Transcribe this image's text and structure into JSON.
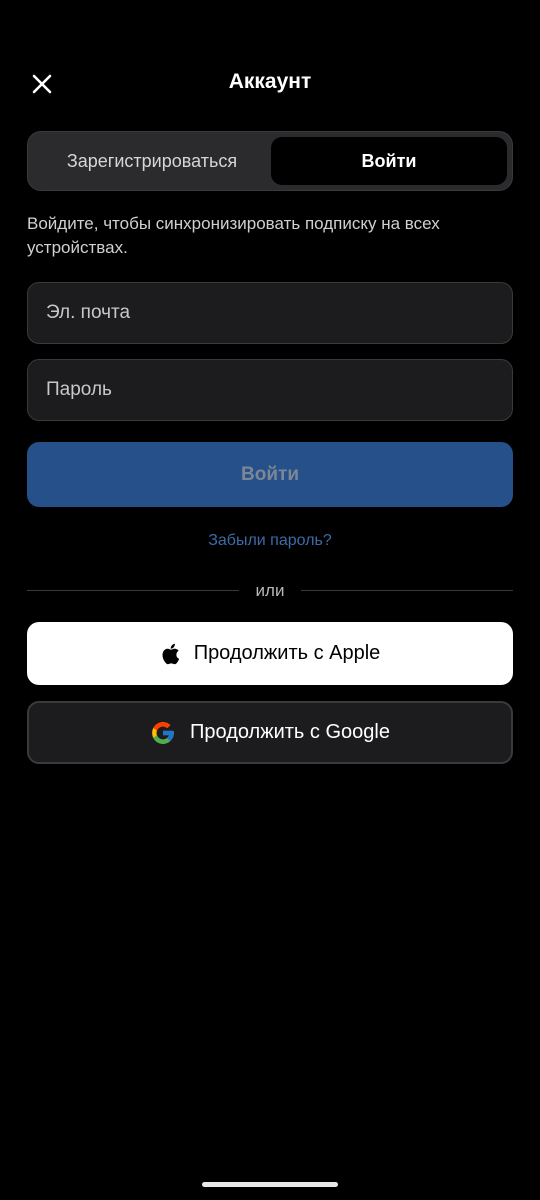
{
  "header": {
    "title": "Аккаунт",
    "close_icon": "close-icon"
  },
  "auth_mode": {
    "register_label": "Зарегистрироваться",
    "login_label": "Войти",
    "selected": "login"
  },
  "description": "Войдите, чтобы синхронизировать подписку на всех устройствах.",
  "form": {
    "email": {
      "placeholder": "Эл. почта",
      "value": ""
    },
    "password": {
      "placeholder": "Пароль",
      "value": ""
    },
    "submit_label": "Войти",
    "forgot_password": "Забыли пароль?"
  },
  "divider": {
    "text": "или"
  },
  "social": {
    "apple": {
      "label": "Продолжить с Apple",
      "icon": "apple-logo-icon"
    },
    "google": {
      "label": "Продолжить с Google",
      "icon": "google-logo-icon"
    }
  },
  "colors": {
    "background": "#000000",
    "accent_disabled": "#26508a",
    "link": "#3d6aa8",
    "field_bg": "#1c1c1e"
  }
}
